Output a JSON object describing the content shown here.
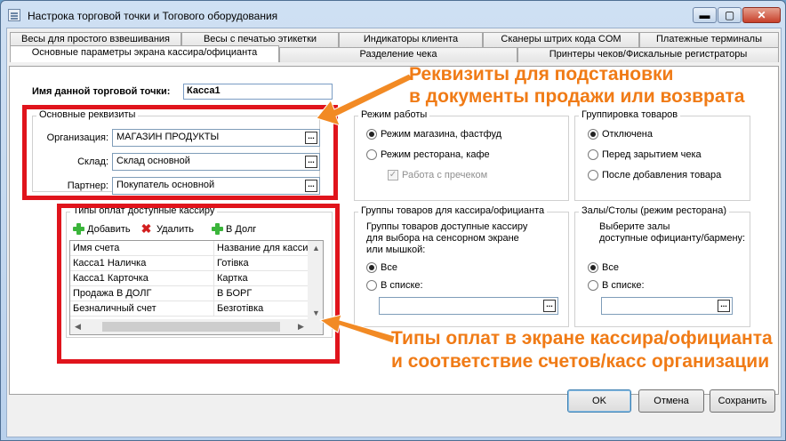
{
  "window": {
    "title": "Настрока торговой точки и Тогового оборудования"
  },
  "tabs_row1": [
    "Весы для простого взвешивания",
    "Весы с печатью этикетки",
    "Индикаторы клиента",
    "Сканеры штрих кода COM",
    "Платежные терминалы"
  ],
  "tabs_row2": [
    "Основные параметры экрана кассира/официанта",
    "Разделение чека",
    "Принтеры чеков/Фискальные регистраторы"
  ],
  "name_label": "Имя данной торговой точки:",
  "name_value": "Касса1",
  "requisites": {
    "title": "Основные реквизиты",
    "org_label": "Организация:",
    "org_value": "МАГАЗИН ПРОДУКТЫ",
    "warehouse_label": "Склад:",
    "warehouse_value": "Склад основной",
    "partner_label": "Партнер:",
    "partner_value": "Покупатель основной",
    "dots": "..."
  },
  "payments": {
    "title": "Типы оплат доступные кассиру",
    "add": "Добавить",
    "delete": "Удалить",
    "debt": "В Долг",
    "columns": [
      "Имя счета",
      "Название для касси"
    ],
    "rows": [
      [
        "Касса1 Наличка",
        "Готівка"
      ],
      [
        "Касса1 Карточка",
        "Картка"
      ],
      [
        "Продажа В ДОЛГ",
        "В БОРГ"
      ],
      [
        "Безналичный счет",
        "Безготівка"
      ]
    ]
  },
  "mode": {
    "title": "Режим работы",
    "opt1": "Режим магазина, фастфуд",
    "opt2": "Режим ресторана, кафе",
    "opt3": "Работа с пречеком"
  },
  "grouping": {
    "title": "Группировка товаров",
    "opt1": "Отключена",
    "opt2": "Перед зарытием чека",
    "opt3": "После добавления товара"
  },
  "product_groups": {
    "title": "Группы товаров для кассира/официанта",
    "desc": [
      "Группы товаров доступные кассиру",
      "для выбора на сенсорном экране",
      "или мышкой:"
    ],
    "all": "Все",
    "list": "В списке:"
  },
  "halls": {
    "title": "Залы/Столы (режим ресторана)",
    "desc": [
      "Выберите залы",
      "доступные официанту/бармену:"
    ],
    "all": "Все",
    "list": "В списке:"
  },
  "annotations": {
    "top1": "Реквизиты для подстановки",
    "top2": "в документы продажи или возврата",
    "bottom1": "Типы оплат в экране кассира/официанта",
    "bottom2": "и соответствие счетов/касс организации",
    "color": "#f07b16"
  },
  "buttons": {
    "ok": "OK",
    "cancel": "Отмена",
    "save": "Сохранить"
  },
  "window_buttons": {
    "min": "▬",
    "max": "▢",
    "close": "✕"
  },
  "colors": {
    "highlight_border": "#e0141c",
    "title_gradient": "#b9d1ec"
  }
}
